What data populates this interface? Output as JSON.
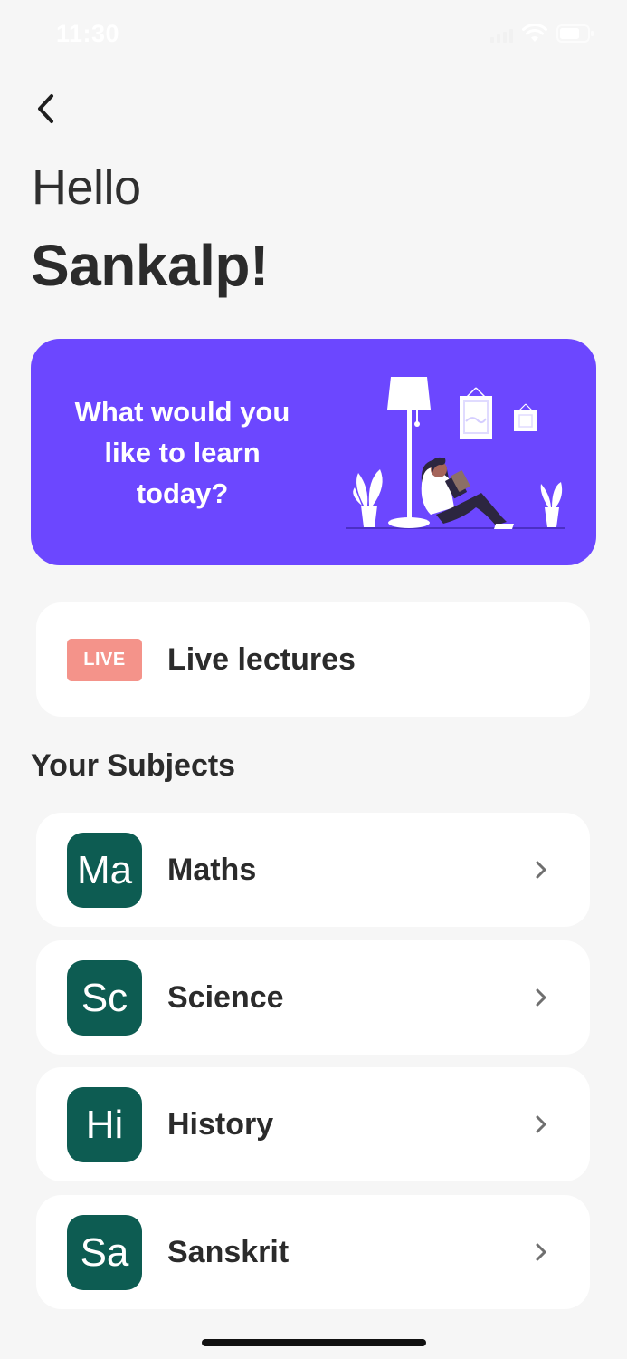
{
  "status_bar": {
    "time": "11:30"
  },
  "header": {
    "greeting": "Hello",
    "user_name": "Sankalp!"
  },
  "banner": {
    "text": "What would you like to learn today?",
    "color": "#6c47ff"
  },
  "live": {
    "badge": "LIVE",
    "label": "Live lectures",
    "badge_color": "#f4938a"
  },
  "subjects_section": {
    "title": "Your Subjects"
  },
  "subjects": [
    {
      "abbr": "Ma",
      "name": "Maths"
    },
    {
      "abbr": "Sc",
      "name": "Science"
    },
    {
      "abbr": "Hi",
      "name": "History"
    },
    {
      "abbr": "Sa",
      "name": "Sanskrit"
    }
  ],
  "colors": {
    "subject_avatar": "#0d5c52",
    "background": "#f6f6f6"
  },
  "icons": [
    "back-arrow-icon",
    "chevron-right-icon",
    "wifi-icon",
    "battery-icon",
    "signal-icon"
  ]
}
